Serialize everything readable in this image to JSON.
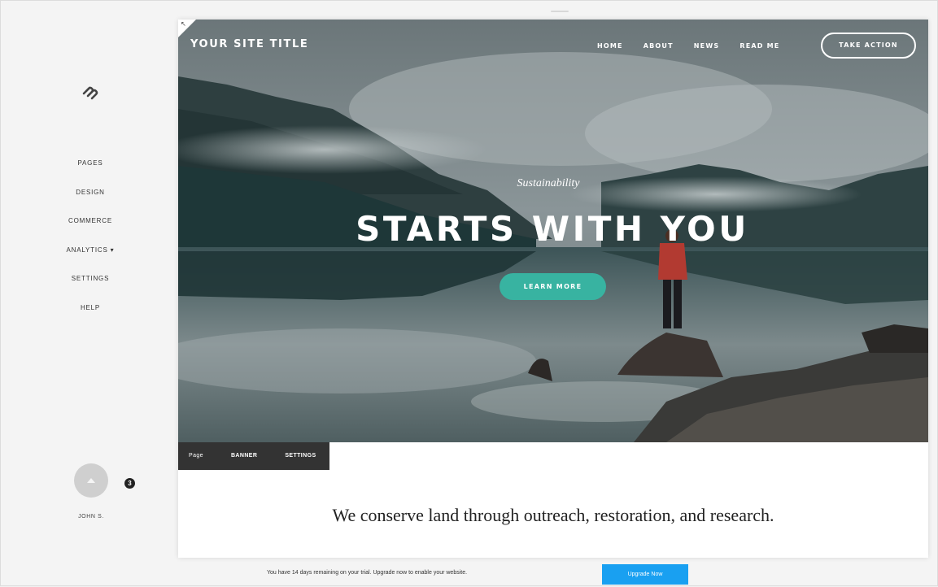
{
  "sidebar": {
    "logo_icon": "squarespace-logo-icon",
    "nav": [
      "PAGES",
      "DESIGN",
      "COMMERCE",
      "ANALYTICS ▾",
      "SETTINGS",
      "HELP"
    ],
    "user": {
      "name": "JOHN S.",
      "badge": "3",
      "avatar_icon": "user-avatar-icon"
    }
  },
  "site": {
    "title": "YOUR SITE TITLE",
    "nav": [
      "HOME",
      "ABOUT",
      "NEWS",
      "READ ME"
    ],
    "cta": "TAKE ACTION",
    "hero": {
      "eyebrow": "Sustainability",
      "headline": "STARTS WITH YOU",
      "button": "LEARN MORE"
    },
    "block_toolbar": [
      "Page",
      "BANNER",
      "SETTINGS"
    ],
    "tagline": "We conserve land through outreach, restoration, and research."
  },
  "trial": {
    "message": "You have 14 days remaining on your trial. Upgrade now to enable your website.",
    "button": "Upgrade Now"
  },
  "colors": {
    "accent": "#38b3a1",
    "upgrade": "#19a0f1",
    "toolbar": "#333333"
  }
}
